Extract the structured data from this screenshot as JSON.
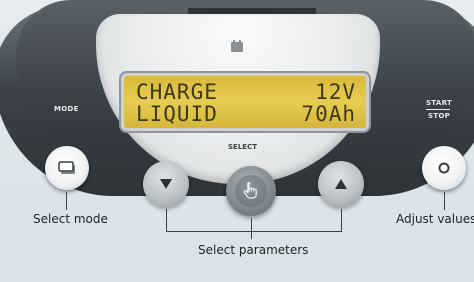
{
  "panel": {
    "mode_label": "MODE",
    "select_label": "SELECT",
    "start_label": "START",
    "stop_label": "STOP"
  },
  "display": {
    "line1_left": "CHARGE",
    "line1_right": "12V",
    "line2_left": "LIQUID",
    "line2_right": "70Ah"
  },
  "captions": {
    "select_mode": "Select mode",
    "select_parameters": "Select parameters",
    "adjust_values": "Adjust values"
  },
  "icons": {
    "mode_button": "mode-icon",
    "down_button": "down-arrow-icon",
    "select_button": "hand-pointer-icon",
    "up_button": "up-arrow-icon",
    "start_stop_button": "circle-icon",
    "battery": "battery-icon"
  },
  "colors": {
    "lcd_background": "#e2c64c",
    "lcd_text": "#3b3a12",
    "frame": "#3a4045"
  }
}
